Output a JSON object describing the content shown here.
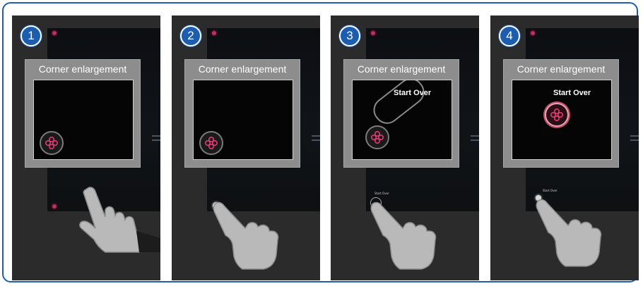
{
  "steps": [
    {
      "number": "1",
      "title": "Corner enlargement",
      "start_over": ""
    },
    {
      "number": "2",
      "title": "Corner enlargement",
      "start_over": ""
    },
    {
      "number": "3",
      "title": "Corner enlargement",
      "start_over": "Start Over",
      "mini_label": "Start Over"
    },
    {
      "number": "4",
      "title": "Corner enlargement",
      "start_over": "Start Over",
      "mini_label": "Start Over"
    }
  ],
  "colors": {
    "frame_border": "#1f5fa8",
    "badge": "#1d5db0",
    "reticle": "#e23a72",
    "panel_bg": "#2b2b2b"
  },
  "icons": [
    "reticle-icon",
    "hand-pointer-icon"
  ]
}
